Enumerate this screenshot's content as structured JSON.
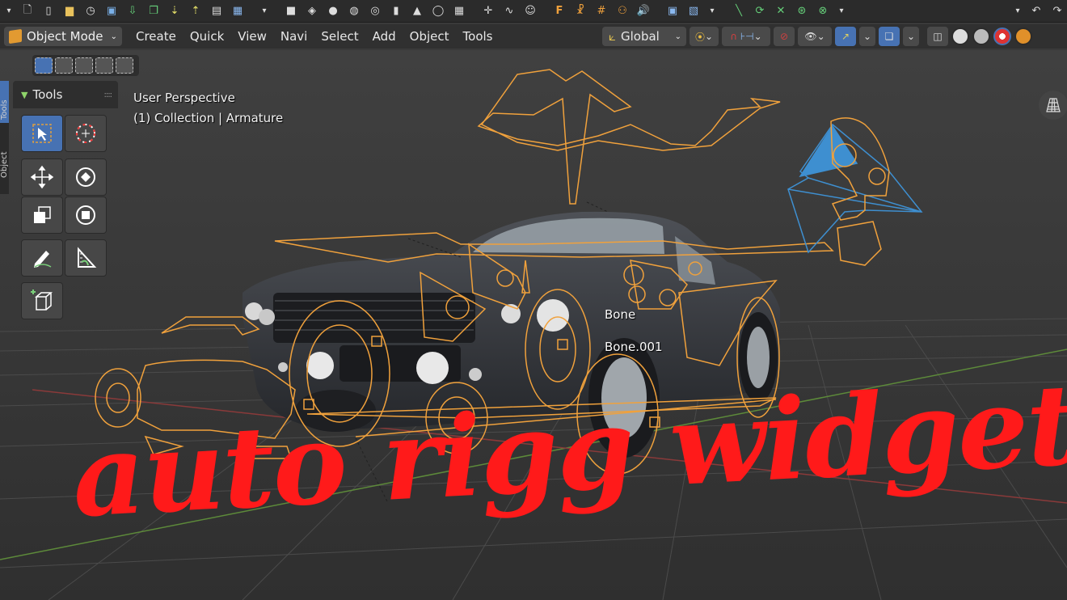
{
  "toolbar": {
    "icons": [
      "menu-chevron",
      "new-file",
      "file",
      "open-folder",
      "recent-files",
      "save",
      "save-down",
      "copy",
      "import",
      "export",
      "render-image",
      "render-anim",
      "add-chevron",
      "cube-plane",
      "cube",
      "sphere",
      "uv-sphere",
      "icosphere",
      "cylinder",
      "cone",
      "torus",
      "grid",
      "empty",
      "curve",
      "monkey",
      "text-f",
      "armature",
      "lattice",
      "metaball",
      "speaker",
      "image-ref",
      "camera-view",
      "light",
      "undo",
      "redo"
    ]
  },
  "header": {
    "mode_label": "Object Mode",
    "menus": [
      "Create",
      "Quick",
      "View",
      "Navi",
      "Select",
      "Add",
      "Object",
      "Tools"
    ],
    "orientation_label": "Global"
  },
  "tools_panel": {
    "title": "Tools"
  },
  "side_tabs": [
    "Tools",
    "Object"
  ],
  "viewport": {
    "perspective_label": "User Perspective",
    "collection_label": "(1) Collection | Armature",
    "bone_labels": [
      "Bone",
      "Bone.001"
    ],
    "overlay_title": "auto rigg widgets"
  },
  "colors": {
    "widget_orange": "#f0a13c",
    "camera_blue": "#3e8fd0",
    "title_red": "#ff1a1a",
    "active_blue": "#4772b3"
  }
}
